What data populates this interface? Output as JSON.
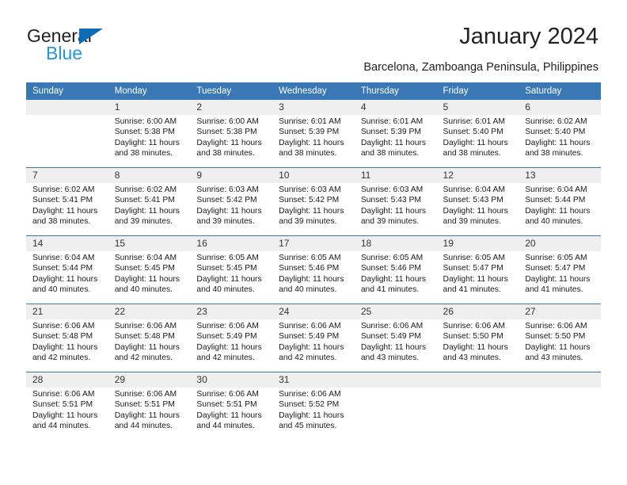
{
  "brand": {
    "name_top": "General",
    "name_bottom": "Blue",
    "triangle_color": "#0d6cb3",
    "blue_text_color": "#2196e3"
  },
  "header": {
    "title": "January 2024",
    "subtitle": "Barcelona, Zamboanga Peninsula, Philippines"
  },
  "theme": {
    "header_row_bg": "#3978b5",
    "daynum_row_bg": "#efefef",
    "body_bg": "#ffffff",
    "text_color": "#1a1a1a"
  },
  "weekday_headers": [
    "Sunday",
    "Monday",
    "Tuesday",
    "Wednesday",
    "Thursday",
    "Friday",
    "Saturday"
  ],
  "weeks": [
    {
      "days": [
        {
          "num": "",
          "sunrise": "",
          "sunset": "",
          "daylight_1": "",
          "daylight_2": "",
          "empty": true
        },
        {
          "num": "1",
          "sunrise": "Sunrise: 6:00 AM",
          "sunset": "Sunset: 5:38 PM",
          "daylight_1": "Daylight: 11 hours",
          "daylight_2": "and 38 minutes.",
          "empty": false
        },
        {
          "num": "2",
          "sunrise": "Sunrise: 6:00 AM",
          "sunset": "Sunset: 5:38 PM",
          "daylight_1": "Daylight: 11 hours",
          "daylight_2": "and 38 minutes.",
          "empty": false
        },
        {
          "num": "3",
          "sunrise": "Sunrise: 6:01 AM",
          "sunset": "Sunset: 5:39 PM",
          "daylight_1": "Daylight: 11 hours",
          "daylight_2": "and 38 minutes.",
          "empty": false
        },
        {
          "num": "4",
          "sunrise": "Sunrise: 6:01 AM",
          "sunset": "Sunset: 5:39 PM",
          "daylight_1": "Daylight: 11 hours",
          "daylight_2": "and 38 minutes.",
          "empty": false
        },
        {
          "num": "5",
          "sunrise": "Sunrise: 6:01 AM",
          "sunset": "Sunset: 5:40 PM",
          "daylight_1": "Daylight: 11 hours",
          "daylight_2": "and 38 minutes.",
          "empty": false
        },
        {
          "num": "6",
          "sunrise": "Sunrise: 6:02 AM",
          "sunset": "Sunset: 5:40 PM",
          "daylight_1": "Daylight: 11 hours",
          "daylight_2": "and 38 minutes.",
          "empty": false
        }
      ]
    },
    {
      "days": [
        {
          "num": "7",
          "sunrise": "Sunrise: 6:02 AM",
          "sunset": "Sunset: 5:41 PM",
          "daylight_1": "Daylight: 11 hours",
          "daylight_2": "and 38 minutes.",
          "empty": false
        },
        {
          "num": "8",
          "sunrise": "Sunrise: 6:02 AM",
          "sunset": "Sunset: 5:41 PM",
          "daylight_1": "Daylight: 11 hours",
          "daylight_2": "and 39 minutes.",
          "empty": false
        },
        {
          "num": "9",
          "sunrise": "Sunrise: 6:03 AM",
          "sunset": "Sunset: 5:42 PM",
          "daylight_1": "Daylight: 11 hours",
          "daylight_2": "and 39 minutes.",
          "empty": false
        },
        {
          "num": "10",
          "sunrise": "Sunrise: 6:03 AM",
          "sunset": "Sunset: 5:42 PM",
          "daylight_1": "Daylight: 11 hours",
          "daylight_2": "and 39 minutes.",
          "empty": false
        },
        {
          "num": "11",
          "sunrise": "Sunrise: 6:03 AM",
          "sunset": "Sunset: 5:43 PM",
          "daylight_1": "Daylight: 11 hours",
          "daylight_2": "and 39 minutes.",
          "empty": false
        },
        {
          "num": "12",
          "sunrise": "Sunrise: 6:04 AM",
          "sunset": "Sunset: 5:43 PM",
          "daylight_1": "Daylight: 11 hours",
          "daylight_2": "and 39 minutes.",
          "empty": false
        },
        {
          "num": "13",
          "sunrise": "Sunrise: 6:04 AM",
          "sunset": "Sunset: 5:44 PM",
          "daylight_1": "Daylight: 11 hours",
          "daylight_2": "and 40 minutes.",
          "empty": false
        }
      ]
    },
    {
      "days": [
        {
          "num": "14",
          "sunrise": "Sunrise: 6:04 AM",
          "sunset": "Sunset: 5:44 PM",
          "daylight_1": "Daylight: 11 hours",
          "daylight_2": "and 40 minutes.",
          "empty": false
        },
        {
          "num": "15",
          "sunrise": "Sunrise: 6:04 AM",
          "sunset": "Sunset: 5:45 PM",
          "daylight_1": "Daylight: 11 hours",
          "daylight_2": "and 40 minutes.",
          "empty": false
        },
        {
          "num": "16",
          "sunrise": "Sunrise: 6:05 AM",
          "sunset": "Sunset: 5:45 PM",
          "daylight_1": "Daylight: 11 hours",
          "daylight_2": "and 40 minutes.",
          "empty": false
        },
        {
          "num": "17",
          "sunrise": "Sunrise: 6:05 AM",
          "sunset": "Sunset: 5:46 PM",
          "daylight_1": "Daylight: 11 hours",
          "daylight_2": "and 40 minutes.",
          "empty": false
        },
        {
          "num": "18",
          "sunrise": "Sunrise: 6:05 AM",
          "sunset": "Sunset: 5:46 PM",
          "daylight_1": "Daylight: 11 hours",
          "daylight_2": "and 41 minutes.",
          "empty": false
        },
        {
          "num": "19",
          "sunrise": "Sunrise: 6:05 AM",
          "sunset": "Sunset: 5:47 PM",
          "daylight_1": "Daylight: 11 hours",
          "daylight_2": "and 41 minutes.",
          "empty": false
        },
        {
          "num": "20",
          "sunrise": "Sunrise: 6:05 AM",
          "sunset": "Sunset: 5:47 PM",
          "daylight_1": "Daylight: 11 hours",
          "daylight_2": "and 41 minutes.",
          "empty": false
        }
      ]
    },
    {
      "days": [
        {
          "num": "21",
          "sunrise": "Sunrise: 6:06 AM",
          "sunset": "Sunset: 5:48 PM",
          "daylight_1": "Daylight: 11 hours",
          "daylight_2": "and 42 minutes.",
          "empty": false
        },
        {
          "num": "22",
          "sunrise": "Sunrise: 6:06 AM",
          "sunset": "Sunset: 5:48 PM",
          "daylight_1": "Daylight: 11 hours",
          "daylight_2": "and 42 minutes.",
          "empty": false
        },
        {
          "num": "23",
          "sunrise": "Sunrise: 6:06 AM",
          "sunset": "Sunset: 5:49 PM",
          "daylight_1": "Daylight: 11 hours",
          "daylight_2": "and 42 minutes.",
          "empty": false
        },
        {
          "num": "24",
          "sunrise": "Sunrise: 6:06 AM",
          "sunset": "Sunset: 5:49 PM",
          "daylight_1": "Daylight: 11 hours",
          "daylight_2": "and 42 minutes.",
          "empty": false
        },
        {
          "num": "25",
          "sunrise": "Sunrise: 6:06 AM",
          "sunset": "Sunset: 5:49 PM",
          "daylight_1": "Daylight: 11 hours",
          "daylight_2": "and 43 minutes.",
          "empty": false
        },
        {
          "num": "26",
          "sunrise": "Sunrise: 6:06 AM",
          "sunset": "Sunset: 5:50 PM",
          "daylight_1": "Daylight: 11 hours",
          "daylight_2": "and 43 minutes.",
          "empty": false
        },
        {
          "num": "27",
          "sunrise": "Sunrise: 6:06 AM",
          "sunset": "Sunset: 5:50 PM",
          "daylight_1": "Daylight: 11 hours",
          "daylight_2": "and 43 minutes.",
          "empty": false
        }
      ]
    },
    {
      "days": [
        {
          "num": "28",
          "sunrise": "Sunrise: 6:06 AM",
          "sunset": "Sunset: 5:51 PM",
          "daylight_1": "Daylight: 11 hours",
          "daylight_2": "and 44 minutes.",
          "empty": false
        },
        {
          "num": "29",
          "sunrise": "Sunrise: 6:06 AM",
          "sunset": "Sunset: 5:51 PM",
          "daylight_1": "Daylight: 11 hours",
          "daylight_2": "and 44 minutes.",
          "empty": false
        },
        {
          "num": "30",
          "sunrise": "Sunrise: 6:06 AM",
          "sunset": "Sunset: 5:51 PM",
          "daylight_1": "Daylight: 11 hours",
          "daylight_2": "and 44 minutes.",
          "empty": false
        },
        {
          "num": "31",
          "sunrise": "Sunrise: 6:06 AM",
          "sunset": "Sunset: 5:52 PM",
          "daylight_1": "Daylight: 11 hours",
          "daylight_2": "and 45 minutes.",
          "empty": false
        },
        {
          "num": "",
          "sunrise": "",
          "sunset": "",
          "daylight_1": "",
          "daylight_2": "",
          "empty": true
        },
        {
          "num": "",
          "sunrise": "",
          "sunset": "",
          "daylight_1": "",
          "daylight_2": "",
          "empty": true
        },
        {
          "num": "",
          "sunrise": "",
          "sunset": "",
          "daylight_1": "",
          "daylight_2": "",
          "empty": true
        }
      ]
    }
  ]
}
